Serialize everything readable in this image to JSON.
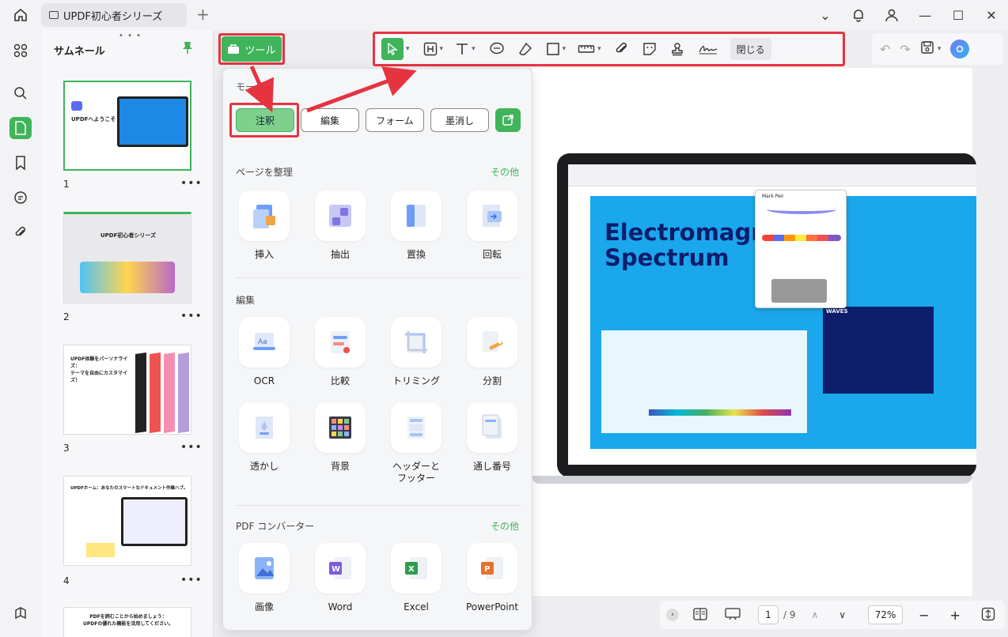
{
  "tab": {
    "title": "UPDF初心者シリーズ"
  },
  "thumbnails": {
    "title": "サムネール",
    "pages": [
      {
        "num": "1",
        "title": "UPDFへようこそ"
      },
      {
        "num": "2",
        "title": "UPDF初心者シリーズ"
      },
      {
        "num": "3",
        "title": "UPDF体験をパーソナライズ：\nテーマを自由にカスタマイズ！"
      },
      {
        "num": "4",
        "title": "UPDFホーム：あなたのスマートなドキュメント作業ハブ。"
      },
      {
        "num": "",
        "title": "PDFを読むことから始めましょう：\nUPDFの優れた機能を活用してください。"
      }
    ]
  },
  "toolbar": {
    "tool_label": "ツール",
    "close_label": "閉じる"
  },
  "panel": {
    "mode_title": "モード",
    "modes": [
      "注釈",
      "編集",
      "フォーム",
      "墨消し"
    ],
    "organize": {
      "title": "ページを整理",
      "more": "その他",
      "tools": [
        "挿入",
        "抽出",
        "置換",
        "回転"
      ]
    },
    "edit": {
      "title": "編集",
      "tools": [
        "OCR",
        "比較",
        "トリミング",
        "分割",
        "透かし",
        "背景",
        "ヘッダーと\nフッター",
        "通し番号"
      ]
    },
    "converter": {
      "title": "PDF コンバーター",
      "more": "その他",
      "tools": [
        "画像",
        "Word",
        "Excel",
        "PowerPoint"
      ]
    }
  },
  "document": {
    "heading": "Electromagnetic\nSpectrum",
    "popup_title": "Mark Pen",
    "waves_label": "WAVES"
  },
  "bottombar": {
    "page_current": "1",
    "page_total": "/ 9",
    "zoom": "72%"
  },
  "colors": {
    "accent": "#3fb45a",
    "highlight_red": "#e53440"
  }
}
